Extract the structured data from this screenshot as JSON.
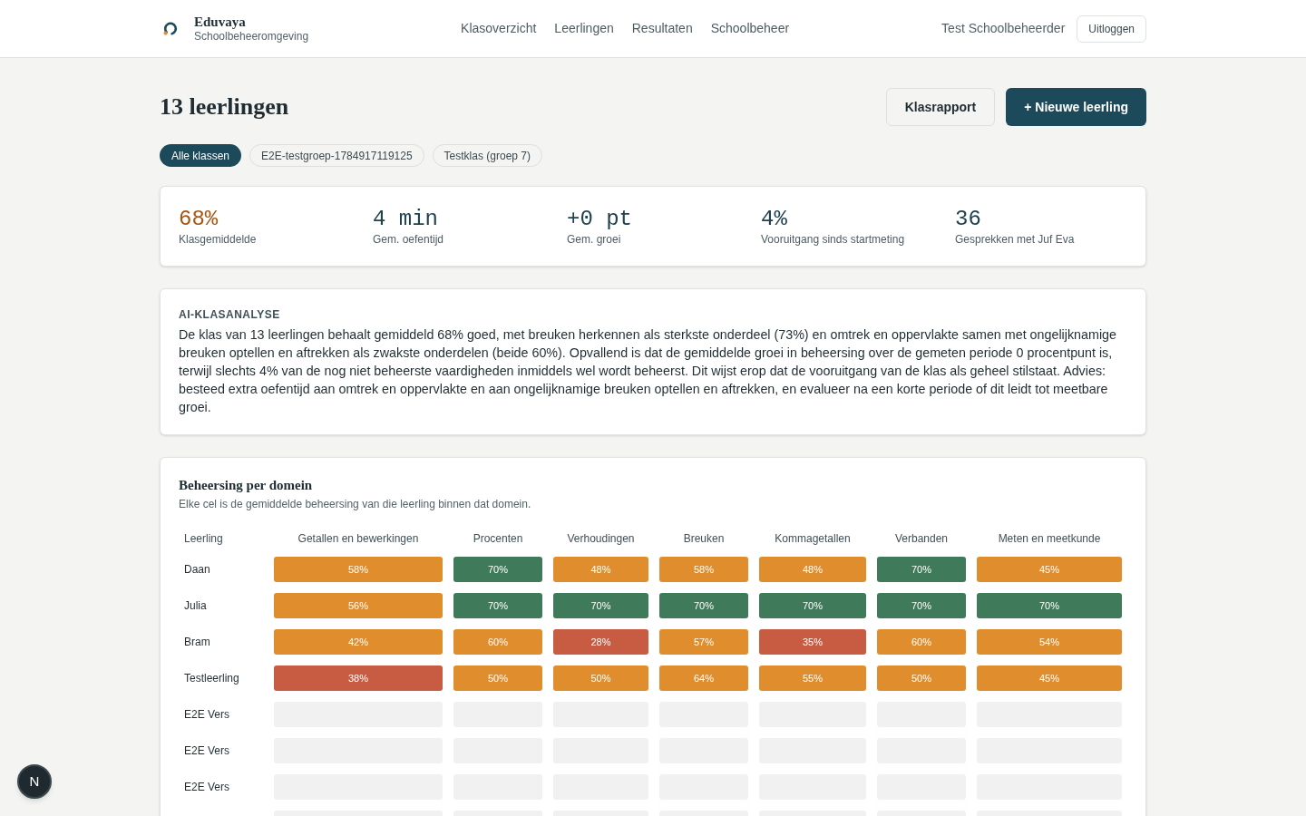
{
  "header": {
    "brand": "Eduvaya",
    "subtitle": "Schoolbeheeromgeving",
    "nav": [
      "Klasoverzicht",
      "Leerlingen",
      "Resultaten",
      "Schoolbeheer"
    ],
    "user": "Test Schoolbeheerder",
    "logout": "Uitloggen"
  },
  "page": {
    "title": "13 leerlingen",
    "actions": [
      {
        "label": "Klasrapport",
        "kind": "secondary"
      },
      {
        "label": "+ Nieuwe leerling",
        "kind": "primary"
      }
    ]
  },
  "filters": [
    {
      "label": "Alle klassen",
      "selected": true
    },
    {
      "label": "E2E-testgroep-1784917119125",
      "selected": false
    },
    {
      "label": "Testklas (groep 7)",
      "selected": false
    }
  ],
  "stats": [
    {
      "value": "68%",
      "label": "Klasgemiddelde",
      "color": "#a8560f"
    },
    {
      "value": "4 min",
      "label": "Gem. oefentijd",
      "color": "#1f4150"
    },
    {
      "value": "+0 pt",
      "label": "Gem. groei",
      "color": "#1f4150"
    },
    {
      "value": "4%",
      "label": "Vooruitgang sinds startmeting",
      "color": "#1f4150"
    },
    {
      "value": "36",
      "label": "Gesprekken met Juf Eva",
      "color": "#1f4150"
    }
  ],
  "analysis": {
    "heading": "AI-KLASANALYSE",
    "text": "De klas van 13 leerlingen behaalt gemiddeld 68% goed, met breuken herkennen als sterkste onderdeel (73%) en omtrek en oppervlakte samen met ongelijknamige breuken optellen en aftrekken als zwakste onderdelen (beide 60%). Opvallend is dat de gemiddelde groei in beheersing over de gemeten periode 0 procentpunt is, terwijl slechts 4% van de nog niet beheerste vaardigheden inmiddels wel wordt beheerst. Dit wijst erop dat de vooruitgang van de klas als geheel stilstaat. Advies: besteed extra oefentijd aan omtrek en oppervlakte en aan ongelijknamige breuken optellen en aftrekken, en evalueer na een korte periode of dit leidt tot meetbare groei."
  },
  "mastery": {
    "title": "Beheersing per domein",
    "subtitle": "Elke cel is de gemiddelde beheersing van die leerling binnen dat domein.",
    "student_column": "Leerling",
    "columns": [
      "Getallen en bewerkingen",
      "Procenten",
      "Verhoudingen",
      "Breuken",
      "Kommagetallen",
      "Verbanden",
      "Meten en meetkunde"
    ],
    "rows": [
      {
        "name": "Daan",
        "cells": [
          {
            "kind": "score",
            "text": "58%",
            "color": "#e08e2d"
          },
          {
            "kind": "score",
            "text": "70%",
            "color": "#3f7a5a"
          },
          {
            "kind": "score",
            "text": "48%",
            "color": "#e08e2d"
          },
          {
            "kind": "score",
            "text": "58%",
            "color": "#e08e2d"
          },
          {
            "kind": "score",
            "text": "48%",
            "color": "#e08e2d"
          },
          {
            "kind": "score",
            "text": "70%",
            "color": "#3f7a5a"
          },
          {
            "kind": "score",
            "text": "45%",
            "color": "#e08e2d"
          }
        ]
      },
      {
        "name": "Julia",
        "cells": [
          {
            "kind": "score",
            "text": "56%",
            "color": "#e08e2d"
          },
          {
            "kind": "score",
            "text": "70%",
            "color": "#3f7a5a"
          },
          {
            "kind": "score",
            "text": "70%",
            "color": "#3f7a5a"
          },
          {
            "kind": "score",
            "text": "70%",
            "color": "#3f7a5a"
          },
          {
            "kind": "score",
            "text": "70%",
            "color": "#3f7a5a"
          },
          {
            "kind": "score",
            "text": "70%",
            "color": "#3f7a5a"
          },
          {
            "kind": "score",
            "text": "70%",
            "color": "#3f7a5a"
          }
        ]
      },
      {
        "name": "Bram",
        "cells": [
          {
            "kind": "score",
            "text": "42%",
            "color": "#e08e2d"
          },
          {
            "kind": "score",
            "text": "60%",
            "color": "#e08e2d"
          },
          {
            "kind": "score",
            "text": "28%",
            "color": "#c75c42"
          },
          {
            "kind": "score",
            "text": "57%",
            "color": "#e08e2d"
          },
          {
            "kind": "score",
            "text": "35%",
            "color": "#c75c42"
          },
          {
            "kind": "score",
            "text": "60%",
            "color": "#e08e2d"
          },
          {
            "kind": "score",
            "text": "54%",
            "color": "#e08e2d"
          }
        ]
      },
      {
        "name": "Testleerling",
        "cells": [
          {
            "kind": "score",
            "text": "38%",
            "color": "#c75c42"
          },
          {
            "kind": "score",
            "text": "50%",
            "color": "#e08e2d"
          },
          {
            "kind": "score",
            "text": "50%",
            "color": "#e08e2d"
          },
          {
            "kind": "score",
            "text": "64%",
            "color": "#e08e2d"
          },
          {
            "kind": "score",
            "text": "55%",
            "color": "#e08e2d"
          },
          {
            "kind": "score",
            "text": "50%",
            "color": "#e08e2d"
          },
          {
            "kind": "score",
            "text": "45%",
            "color": "#e08e2d"
          }
        ]
      },
      {
        "name": "E2E Vers",
        "cells": [
          {
            "kind": "empty"
          },
          {
            "kind": "empty"
          },
          {
            "kind": "empty"
          },
          {
            "kind": "empty"
          },
          {
            "kind": "empty"
          },
          {
            "kind": "empty"
          },
          {
            "kind": "empty"
          }
        ]
      },
      {
        "name": "E2E Vers",
        "cells": [
          {
            "kind": "empty"
          },
          {
            "kind": "empty"
          },
          {
            "kind": "empty"
          },
          {
            "kind": "empty"
          },
          {
            "kind": "empty"
          },
          {
            "kind": "empty"
          },
          {
            "kind": "empty"
          }
        ]
      },
      {
        "name": "E2E Vers",
        "cells": [
          {
            "kind": "empty"
          },
          {
            "kind": "empty"
          },
          {
            "kind": "empty"
          },
          {
            "kind": "empty"
          },
          {
            "kind": "empty"
          },
          {
            "kind": "empty"
          },
          {
            "kind": "empty"
          }
        ]
      },
      {
        "cells": [
          {
            "kind": "empty"
          },
          {
            "kind": "empty"
          },
          {
            "kind": "empty"
          },
          {
            "kind": "empty"
          },
          {
            "kind": "empty"
          },
          {
            "kind": "empty"
          },
          {
            "kind": "empty"
          }
        ]
      }
    ]
  },
  "dev_indicator": {
    "label": "N"
  }
}
